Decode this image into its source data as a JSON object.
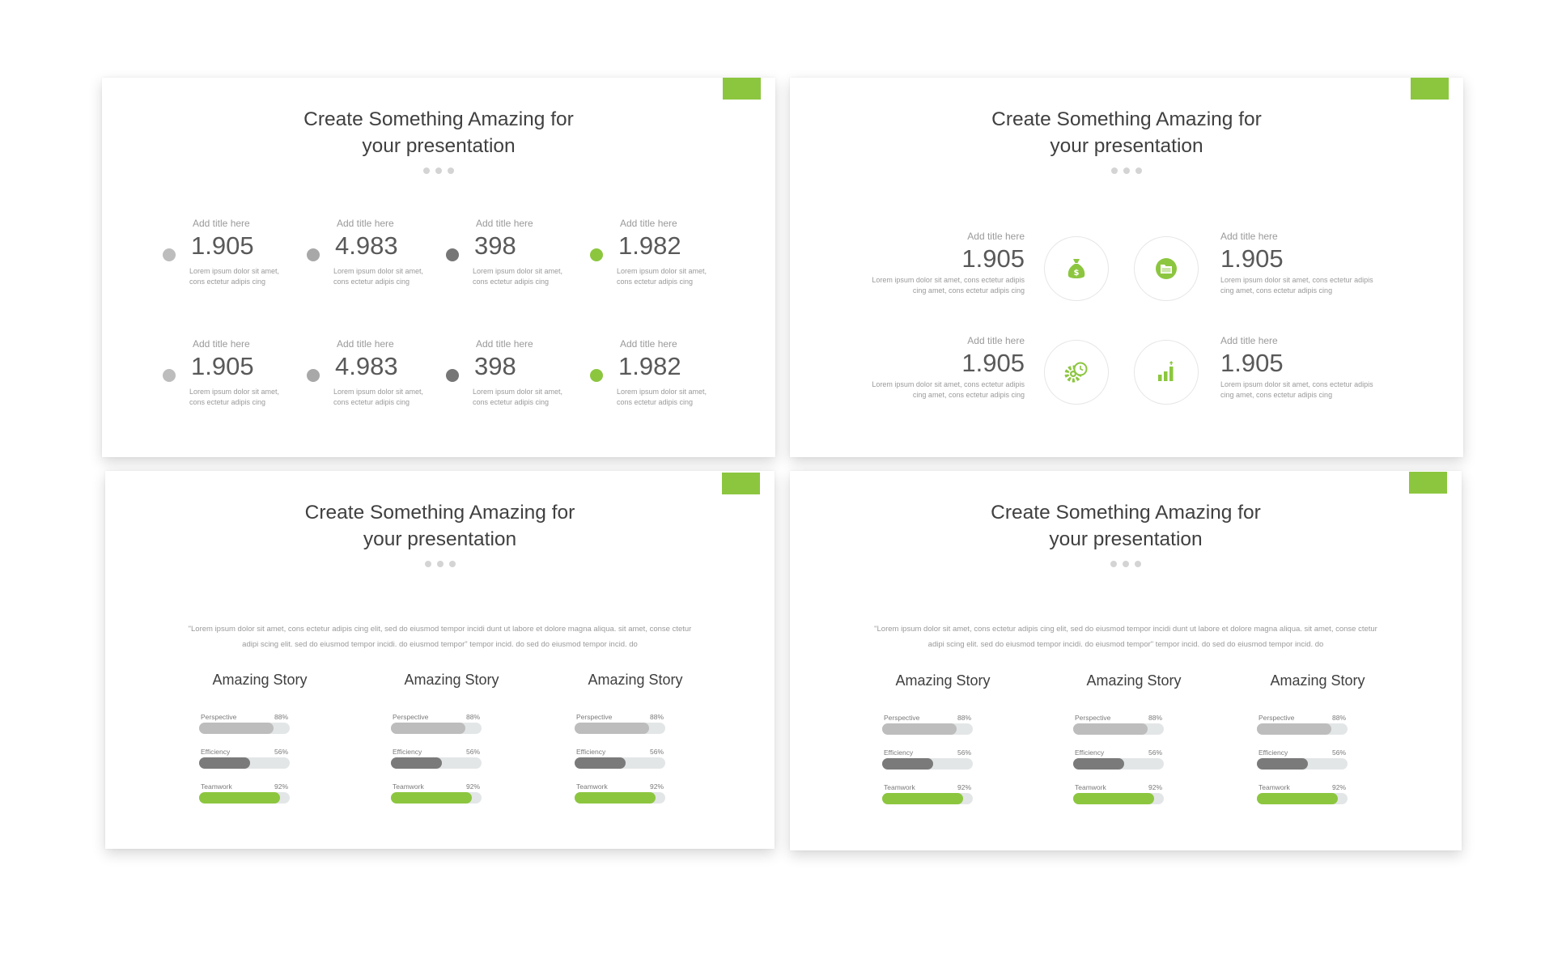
{
  "colors": {
    "accent": "#8cc63f",
    "gray_light": "#bdbdbd",
    "gray_dark": "#7a7a7a",
    "track": "#e3e6e7"
  },
  "slides": [
    {
      "title_line1": "Create Something Amazing for",
      "title_line2": "your presentation",
      "stats": [
        {
          "title": "Add title here",
          "value": "1.905",
          "desc1": "Lorem ipsum dolor sit amet,",
          "desc2": "cons ectetur adipis cing",
          "dot_color": "#bdbdbd"
        },
        {
          "title": "Add title here",
          "value": "4.983",
          "desc1": "Lorem ipsum dolor sit amet,",
          "desc2": "cons ectetur adipis cing",
          "dot_color": "#a8a8a8"
        },
        {
          "title": "Add title here",
          "value": "398",
          "desc1": "Lorem ipsum dolor sit amet,",
          "desc2": "cons ectetur adipis cing",
          "dot_color": "#767676"
        },
        {
          "title": "Add title here",
          "value": "1.982",
          "desc1": "Lorem ipsum dolor sit amet,",
          "desc2": "cons ectetur adipis cing",
          "dot_color": "#8cc63f"
        },
        {
          "title": "Add title here",
          "value": "1.905",
          "desc1": "Lorem ipsum dolor sit amet,",
          "desc2": "cons ectetur adipis cing",
          "dot_color": "#bdbdbd"
        },
        {
          "title": "Add title here",
          "value": "4.983",
          "desc1": "Lorem ipsum dolor sit amet,",
          "desc2": "cons ectetur adipis cing",
          "dot_color": "#a8a8a8"
        },
        {
          "title": "Add title here",
          "value": "398",
          "desc1": "Lorem ipsum dolor sit amet,",
          "desc2": "cons ectetur adipis cing",
          "dot_color": "#767676"
        },
        {
          "title": "Add title here",
          "value": "1.982",
          "desc1": "Lorem ipsum dolor sit amet,",
          "desc2": "cons ectetur adipis cing",
          "dot_color": "#8cc63f"
        }
      ]
    },
    {
      "title_line1": "Create Something Amazing for",
      "title_line2": "your presentation",
      "features": [
        {
          "title": "Add title here",
          "value": "1.905",
          "desc1": "Lorem ipsum dolor sit amet, cons ectetur adipis",
          "desc2": "cing amet, cons ectetur adipis cing",
          "icon": "money-bag-icon"
        },
        {
          "title": "Add title here",
          "value": "1.905",
          "desc1": "Lorem ipsum dolor sit amet, cons ectetur adipis",
          "desc2": "cing amet, cons ectetur adipis cing",
          "icon": "folder-icon"
        },
        {
          "title": "Add title here",
          "value": "1.905",
          "desc1": "Lorem ipsum dolor sit amet, cons ectetur adipis",
          "desc2": "cing amet, cons ectetur adipis cing",
          "icon": "gear-clock-icon"
        },
        {
          "title": "Add title here",
          "value": "1.905",
          "desc1": "Lorem ipsum dolor sit amet, cons ectetur adipis",
          "desc2": "cing amet, cons ectetur adipis cing",
          "icon": "bar-chart-icon"
        }
      ]
    },
    {
      "title_line1": "Create Something Amazing for",
      "title_line2": "your presentation",
      "quote_line1": "\"Lorem ipsum dolor sit amet, cons ectetur adipis cing elit, sed do eiusmod tempor incidi dunt ut labore et dolore magna aliqua. sit amet, conse ctetur",
      "quote_line2": "adipi scing elit. sed do eiusmod tempor incidi. do eiusmod tempor\"  tempor incid. do sed do eiusmod tempor incid. do",
      "stories": [
        {
          "heading": "Amazing Story",
          "skills": [
            {
              "label": "Perspective",
              "pct": "88%",
              "value": 0.82
            },
            {
              "label": "Efficiency",
              "pct": "56%",
              "value": 0.56
            },
            {
              "label": "Teamwork",
              "pct": "92%",
              "value": 0.89
            }
          ]
        },
        {
          "heading": "Amazing Story",
          "skills": [
            {
              "label": "Perspective",
              "pct": "88%",
              "value": 0.82
            },
            {
              "label": "Efficiency",
              "pct": "56%",
              "value": 0.56
            },
            {
              "label": "Teamwork",
              "pct": "92%",
              "value": 0.89
            }
          ]
        },
        {
          "heading": "Amazing Story",
          "skills": [
            {
              "label": "Perspective",
              "pct": "88%",
              "value": 0.82
            },
            {
              "label": "Efficiency",
              "pct": "56%",
              "value": 0.56
            },
            {
              "label": "Teamwork",
              "pct": "92%",
              "value": 0.89
            }
          ]
        }
      ]
    },
    {
      "title_line1": "Create Something Amazing for",
      "title_line2": "your presentation",
      "quote_line1": "\"Lorem ipsum dolor sit amet, cons ectetur adipis cing elit, sed do eiusmod tempor incidi dunt ut labore et dolore magna aliqua. sit amet, conse ctetur",
      "quote_line2": "adipi scing elit. sed do eiusmod tempor incidi. do eiusmod tempor\"  tempor incid. do sed do eiusmod tempor incid. do",
      "stories": [
        {
          "heading": "Amazing Story",
          "skills": [
            {
              "label": "Perspective",
              "pct": "88%",
              "value": 0.82
            },
            {
              "label": "Efficiency",
              "pct": "56%",
              "value": 0.56
            },
            {
              "label": "Teamwork",
              "pct": "92%",
              "value": 0.89
            }
          ]
        },
        {
          "heading": "Amazing Story",
          "skills": [
            {
              "label": "Perspective",
              "pct": "88%",
              "value": 0.82
            },
            {
              "label": "Efficiency",
              "pct": "56%",
              "value": 0.56
            },
            {
              "label": "Teamwork",
              "pct": "92%",
              "value": 0.89
            }
          ]
        },
        {
          "heading": "Amazing Story",
          "skills": [
            {
              "label": "Perspective",
              "pct": "88%",
              "value": 0.82
            },
            {
              "label": "Efficiency",
              "pct": "56%",
              "value": 0.56
            },
            {
              "label": "Teamwork",
              "pct": "92%",
              "value": 0.89
            }
          ]
        }
      ]
    }
  ]
}
